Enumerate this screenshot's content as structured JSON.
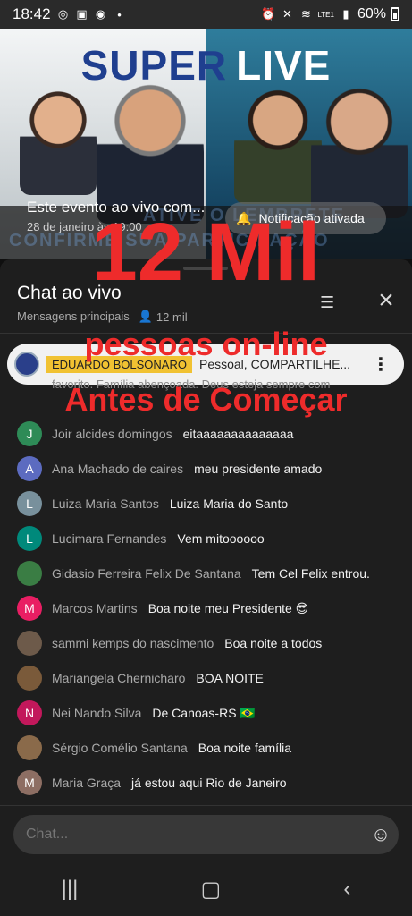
{
  "status": {
    "time": "18:42",
    "battery": "60%",
    "network": "LTE1"
  },
  "banner": {
    "title_word1": "SUPER",
    "title_word2": "LIVE",
    "deco_line1": "ATIVE O LEMBRETE",
    "deco_line2": "CONFIRME SUA PARTICIPAÇÃO",
    "event_title": "Este evento ao vivo com...",
    "event_date": "28 de janeiro às 19:00",
    "notification_label": "Notificação ativada"
  },
  "chat": {
    "title": "Chat ao vivo",
    "filter": "Mensagens principais",
    "viewers": "12 mil",
    "pinned": {
      "author": "EDUARDO BOLSONARO",
      "message": "Pessoal, COMPARTILHE..."
    },
    "faded_message": "favorito. Família abençoada. Deus esteja sempre com",
    "messages": [
      {
        "initial": "J",
        "color": "#2e8b57",
        "author": "Joir alcides domingos",
        "text": "eitaaaaaaaaaaaaaa"
      },
      {
        "initial": "A",
        "color": "#5c6bc0",
        "author": "Ana Machado de caires",
        "text": "meu presidente amado"
      },
      {
        "initial": "L",
        "color": "#78909c",
        "author": "Luiza Maria Santos",
        "text": "Luiza Maria do Santo"
      },
      {
        "initial": "L",
        "color": "#00897b",
        "author": "Lucimara Fernandes",
        "text": "Vem mitoooooo"
      },
      {
        "initial": "",
        "color": "#3a7d44",
        "author": "Gidasio Ferreira Felix De Santana",
        "text": "Tem Cel Felix entrou."
      },
      {
        "initial": "M",
        "color": "#e91e63",
        "author": "Marcos Martins",
        "text": "Boa noite meu Presidente 😎"
      },
      {
        "initial": "",
        "color": "#6d5a4a",
        "author": "sammi kemps do nascimento",
        "text": "Boa noite a todos"
      },
      {
        "initial": "",
        "color": "#7a5a3a",
        "author": "Mariangela Chernicharo",
        "text": "BOA NOITE"
      },
      {
        "initial": "N",
        "color": "#c2185b",
        "author": "Nei Nando Silva",
        "text": "De Canoas-RS 🇧🇷"
      },
      {
        "initial": "",
        "color": "#8a6a4a",
        "author": "Sérgio Comélio Santana",
        "text": "Boa noite família"
      },
      {
        "initial": "M",
        "color": "#8d6e63",
        "author": "Maria Graça",
        "text": "já estou aqui Rio de Janeiro"
      }
    ],
    "input_placeholder": "Chat..."
  },
  "overlay": {
    "big": "12 Mil",
    "mid": "pessoas on-line",
    "low": "Antes de Começar"
  },
  "icons": {
    "close": "close-icon",
    "filter": "filter-icon",
    "emoji": "emoji-icon",
    "bell": "bell-icon"
  }
}
